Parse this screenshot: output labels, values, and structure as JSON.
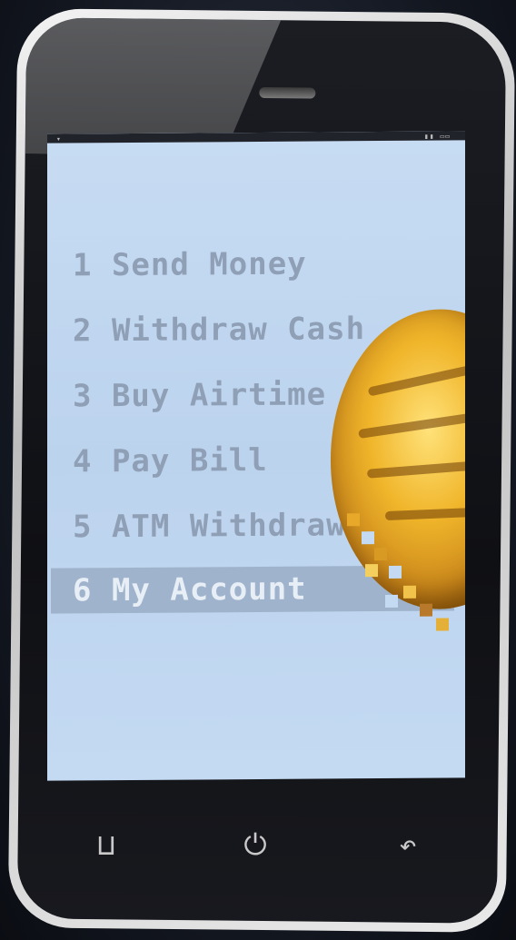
{
  "menu": {
    "items": [
      {
        "label": "1 Send Money",
        "selected": false
      },
      {
        "label": "2 Withdraw Cash",
        "selected": false
      },
      {
        "label": "3 Buy Airtime",
        "selected": false
      },
      {
        "label": "4 Pay Bill",
        "selected": false
      },
      {
        "label": "5 ATM Withdrawal",
        "selected": false
      },
      {
        "label": "6 My Account",
        "selected": true
      }
    ]
  },
  "nav": {
    "menu_icon": "menu-icon",
    "power_icon": "power-icon",
    "back_icon": "back-icon"
  },
  "colors": {
    "screen": "#c4daf3",
    "menu_text": "#8fa0b6",
    "highlight": "#9fb4cc",
    "coin": "#f0b52a"
  }
}
